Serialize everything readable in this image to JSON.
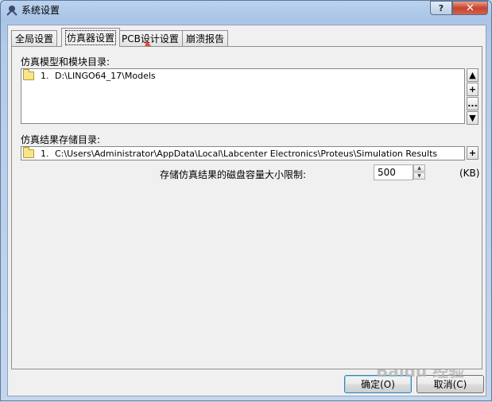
{
  "window": {
    "title": "系统设置",
    "help_label": "?",
    "close_label": "✕"
  },
  "tabs": [
    {
      "label": "全局设置",
      "active": false
    },
    {
      "label": "仿真器设置",
      "active": true
    },
    {
      "label": "PCB设计设置",
      "active": false
    },
    {
      "label": "崩溃报告",
      "active": false
    }
  ],
  "models": {
    "label": "仿真模型和模块目录:",
    "items": [
      {
        "num": "1.",
        "path": "D:\\LINGO64_17\\Models"
      }
    ],
    "buttons": {
      "up": "▲",
      "add": "+",
      "more": "...",
      "down": "▼"
    }
  },
  "results": {
    "label": "仿真结果存储目录:",
    "items": [
      {
        "num": "1.",
        "path": "C:\\Users\\Administrator\\AppData\\Local\\Labcenter Electronics\\Proteus\\Simulation Results"
      }
    ],
    "add_button": "+"
  },
  "disk_limit": {
    "label": "存储仿真结果的磁盘容量大小限制:",
    "value": "500",
    "unit": "(KB)"
  },
  "footer": {
    "ok_label": "确定(O)",
    "cancel_label": "取消(C)"
  },
  "watermark": "Baidu 经验",
  "colors": {
    "annotation_red": "#e8473b",
    "close_button": "#c8432d"
  }
}
